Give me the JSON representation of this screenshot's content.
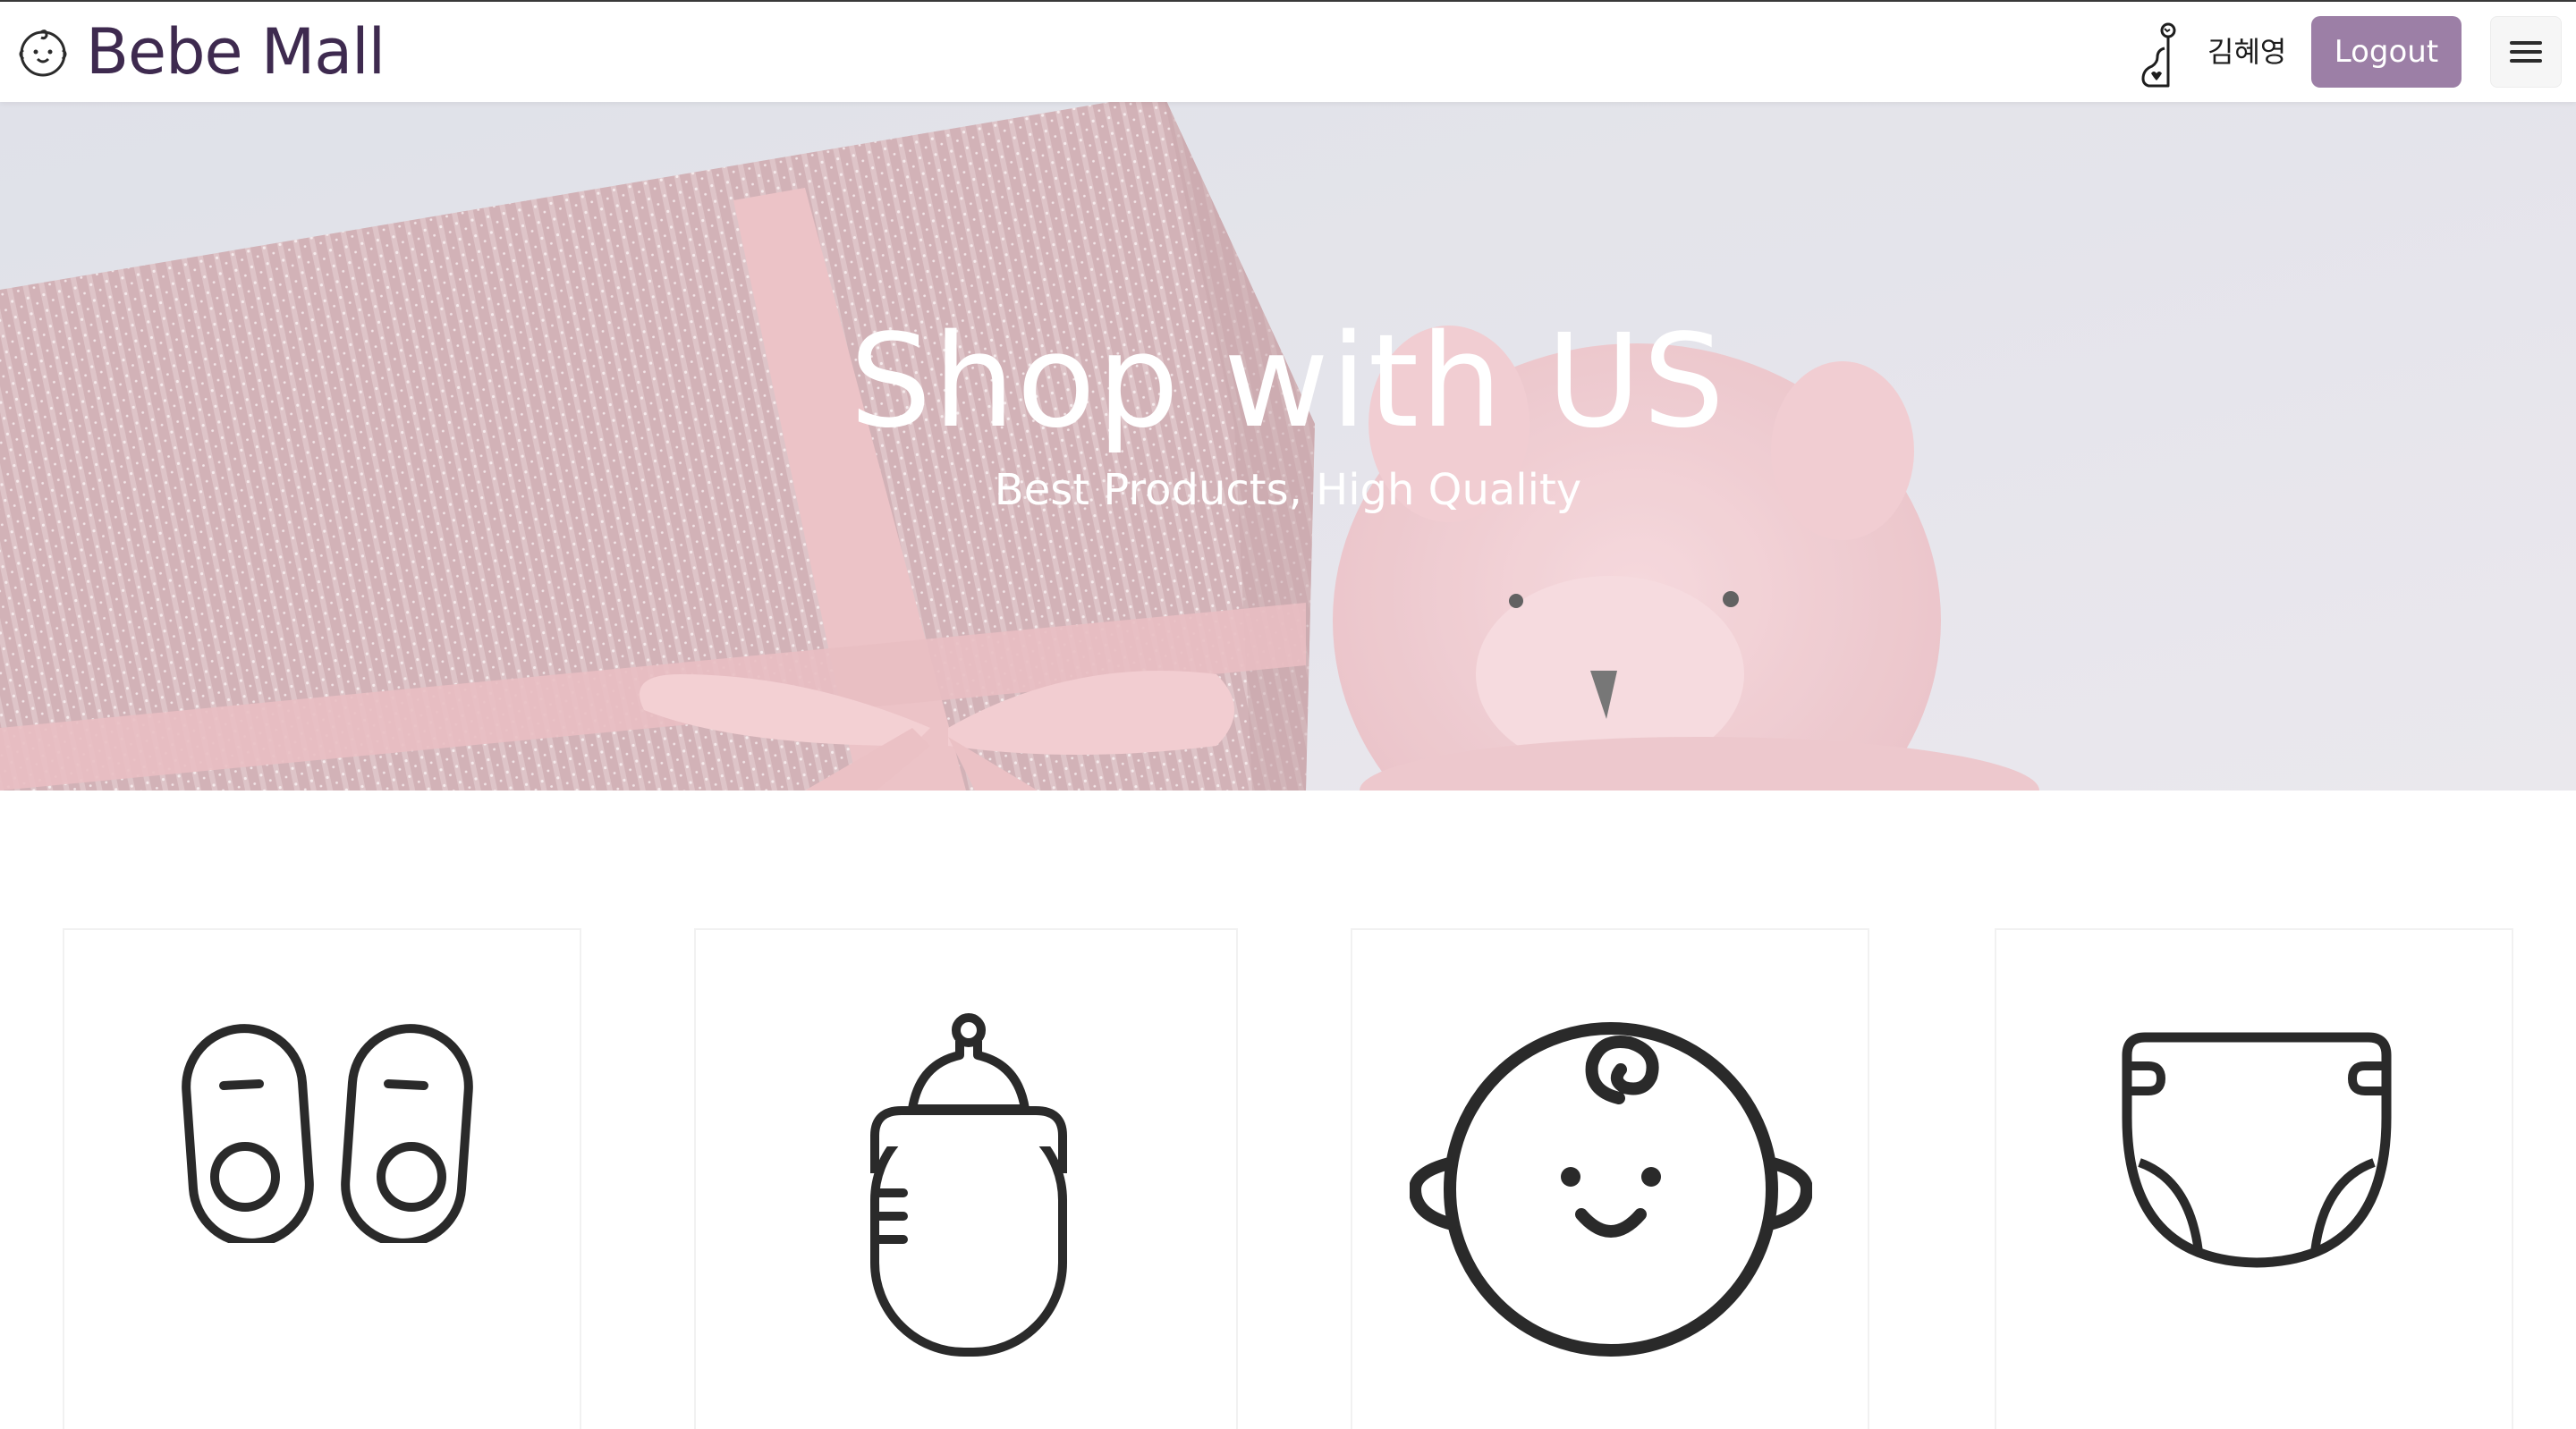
{
  "brand": {
    "name": "Bebe Mall",
    "icon": "baby-face-icon"
  },
  "header": {
    "user_icon": "parent-baby-icon",
    "user_name": "김혜영",
    "logout_label": "Logout",
    "menu_icon": "hamburger-icon"
  },
  "hero": {
    "title": "Shop with US",
    "subtitle": "Best Products, High Quality"
  },
  "categories": [
    {
      "icon": "baby-shoes-icon"
    },
    {
      "icon": "baby-bottle-icon"
    },
    {
      "icon": "baby-face-icon"
    },
    {
      "icon": "diaper-icon"
    }
  ],
  "colors": {
    "accent": "#9c7fa6",
    "brand_text": "#3e2a4f",
    "hero_tint": "#e4dde8"
  }
}
